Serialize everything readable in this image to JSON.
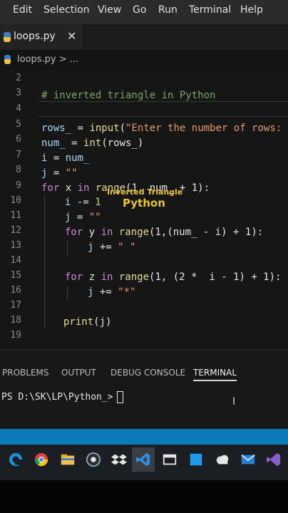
{
  "menu": [
    "Edit",
    "Selection",
    "View",
    "Go",
    "Run",
    "Terminal",
    "Help"
  ],
  "tab": {
    "filename": "loops.py",
    "close": "✕"
  },
  "breadcrumb": "loops.py > ...",
  "editor": {
    "line_numbers": [
      "2",
      "3",
      "4",
      "5",
      "6",
      "7",
      "8",
      "9",
      "10",
      "11",
      "12",
      "13",
      "14",
      "15",
      "16",
      "17",
      "18",
      "19"
    ],
    "lines": {
      "l3": "# inverted triangle in Python",
      "l5": {
        "var": "rows_",
        "op": " = ",
        "fn": "input",
        "open": "(",
        "str": "\"Enter the number of rows:"
      },
      "l6": {
        "var": "num_",
        "op": " = ",
        "fn": "int",
        "rest": "(rows_)"
      },
      "l7": {
        "var": "i",
        "op": " = ",
        "rest": "num_"
      },
      "l8": {
        "var": "j",
        "op": " = ",
        "str": "\"\""
      },
      "l9": {
        "kw": "for",
        "var": " x ",
        "kw2": "in",
        "fn": " range",
        "rest": "(1, num_ + 1):"
      },
      "l10": {
        "var": "i",
        "rest": " -= ",
        "num": "1"
      },
      "l11": {
        "var": "j",
        "op": " = ",
        "str": "\"\""
      },
      "l12": {
        "kw": "for",
        "var": " y ",
        "kw2": "in",
        "fn": " range",
        "rest": "(1,(num_ - i) + 1):"
      },
      "l13": {
        "var": "j",
        "op": " += ",
        "str": "\" \""
      },
      "l15": {
        "kw": "for",
        "var": " z ",
        "kw2": "in",
        "fn": " range",
        "rest": "(1, (2 *  i - 1) + 1):"
      },
      "l16": {
        "var": "j",
        "op": " += ",
        "str": "\"*\""
      },
      "l18": {
        "fn": "print",
        "rest": "(j)"
      }
    }
  },
  "overlay": {
    "line1": "Inverted Triangle",
    "line2": "Python"
  },
  "panel": {
    "tabs": [
      "PROBLEMS",
      "OUTPUT",
      "DEBUG CONSOLE",
      "TERMINAL"
    ],
    "active_tab": "TERMINAL",
    "prompt": "PS D:\\SK\\LP\\Python_>"
  },
  "colors": {
    "status_bar": "#0b7ab8",
    "accent_vscode": "#2f8fe0"
  },
  "taskbar_icons": [
    "edge-icon",
    "chrome-icon",
    "file-explorer-icon",
    "app-icon",
    "dropbox-icon",
    "vscode-icon",
    "window-icon",
    "blue-square-icon",
    "cloud-app-icon",
    "mail-icon",
    "visual-studio-icon"
  ]
}
